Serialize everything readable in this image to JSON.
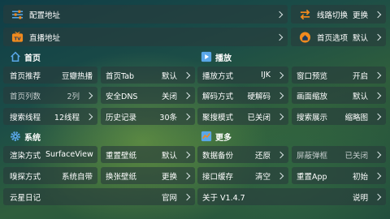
{
  "top": {
    "config_label": "配置地址",
    "live_label": "直播地址",
    "line_label": "线路切换",
    "line_value": "更换",
    "homepage_opt_label": "首页选项",
    "homepage_opt_value": "默认"
  },
  "sections": {
    "home": "首页",
    "playback": "播放",
    "system": "系统",
    "more": "更多"
  },
  "home": {
    "recommend_label": "首页推荐",
    "recommend_value": "豆瓣热播",
    "tab_label": "首页Tab",
    "tab_value": "默认",
    "cols_label": "首页列数",
    "cols_value": "2列",
    "dns_label": "安全DNS",
    "dns_value": "关闭",
    "thread_label": "搜索线程",
    "thread_value": "12线程",
    "history_label": "历史记录",
    "history_value": "30条"
  },
  "playback": {
    "mode_label": "播放方式",
    "mode_value": "IJK",
    "preview_label": "窗口预览",
    "preview_value": "开启",
    "decode_label": "解码方式",
    "decode_value": "硬解码",
    "scale_label": "画面缩放",
    "scale_value": "默认",
    "aggregate_label": "聚搜模式",
    "aggregate_value": "已关闭",
    "search_label": "搜索展示",
    "search_value": "缩略图"
  },
  "system": {
    "render_label": "渲染方式",
    "render_value": "SurfaceView",
    "reset_wall_label": "重置壁纸",
    "reset_wall_value": "默认",
    "sniff_label": "嗅探方式",
    "sniff_value": "系统自带",
    "change_wall_label": "换张壁纸",
    "change_wall_value": "更换",
    "diary_label": "云星日记",
    "diary_value": "官网"
  },
  "more": {
    "backup_label": "数据备份",
    "backup_value": "还原",
    "popup_label": "屏蔽弹框",
    "popup_value": "已关闭",
    "cache_label": "接口缓存",
    "cache_value": "清空",
    "reset_app_label": "重置App",
    "reset_app_value": "初始",
    "about_label": "关于 V1.4.7",
    "about_value": "说明"
  },
  "icons": {
    "config": "sliders-icon",
    "live": "tv-icon",
    "line": "swap-icon",
    "homepage_opt": "home-icon",
    "home": "home-outline-icon",
    "playback": "play-square-icon",
    "system": "gear-icon",
    "more": "settings-chart-icon"
  },
  "colors": {
    "accent_orange": "#f08a1e",
    "accent_blue": "#5aa7e8",
    "panel": "#2a3f3f"
  }
}
